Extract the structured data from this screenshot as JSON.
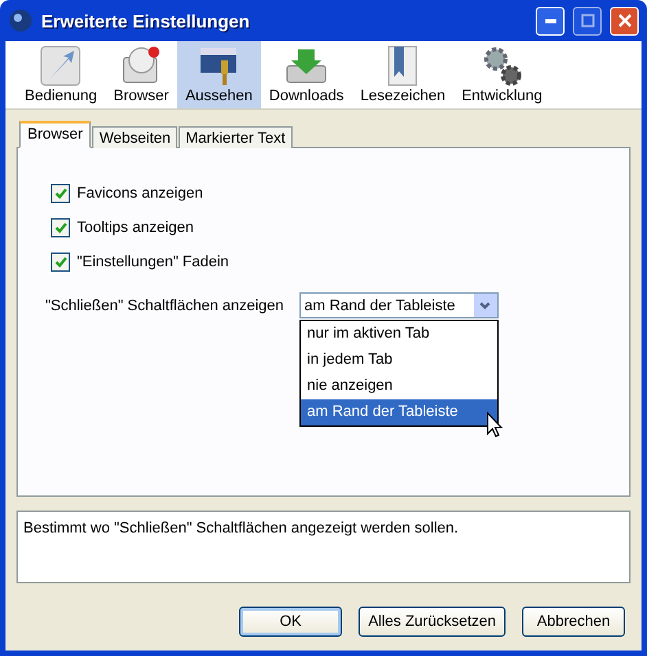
{
  "window": {
    "title": "Erweiterte Einstellungen"
  },
  "toolbar": [
    {
      "label": "Bedienung",
      "kind": "pointer",
      "selected": false
    },
    {
      "label": "Browser",
      "kind": "browser",
      "selected": false
    },
    {
      "label": "Aussehen",
      "kind": "brush",
      "selected": true
    },
    {
      "label": "Downloads",
      "kind": "download",
      "selected": false
    },
    {
      "label": "Lesezeichen",
      "kind": "bookmark",
      "selected": false
    },
    {
      "label": "Entwicklung",
      "kind": "gears",
      "selected": false
    }
  ],
  "tabs": [
    {
      "label": "Browser",
      "selected": true
    },
    {
      "label": "Webseiten",
      "selected": false
    },
    {
      "label": "Markierter Text",
      "selected": false
    }
  ],
  "options": [
    {
      "label": "Favicons anzeigen",
      "checked": true
    },
    {
      "label": "Tooltips anzeigen",
      "checked": true
    },
    {
      "label": "\"Einstellungen\" Fadein",
      "checked": true
    }
  ],
  "close_buttons": {
    "label": "\"Schließen\" Schaltflächen anzeigen",
    "value": "am Rand der Tableiste",
    "expanded": true,
    "options": [
      {
        "label": "nur im aktiven Tab",
        "selected": false
      },
      {
        "label": "in jedem Tab",
        "selected": false
      },
      {
        "label": "nie anzeigen",
        "selected": false
      },
      {
        "label": "am Rand der Tableiste",
        "selected": true
      }
    ]
  },
  "description": "Bestimmt wo \"Schließen\" Schaltflächen angezeigt werden sollen.",
  "buttons": [
    {
      "label": "OK",
      "kind": "default"
    },
    {
      "label": "Alles Zurücksetzen",
      "kind": "normal"
    },
    {
      "label": "Abbrechen",
      "kind": "normal"
    }
  ]
}
